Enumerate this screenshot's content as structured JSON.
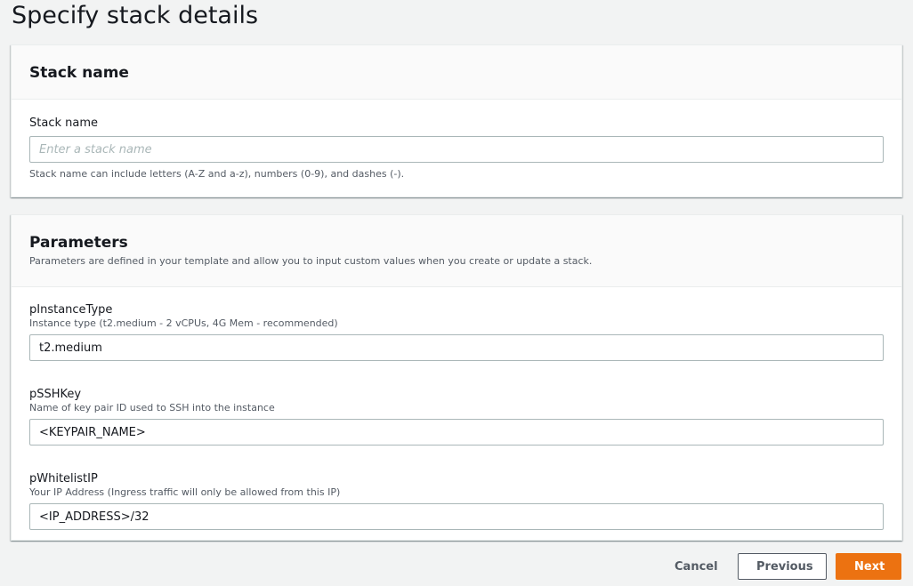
{
  "page": {
    "title": "Specify stack details"
  },
  "stack_name_panel": {
    "heading": "Stack name",
    "field_label": "Stack name",
    "placeholder": "Enter a stack name",
    "value": "",
    "hint": "Stack name can include letters (A-Z and a-z), numbers (0-9), and dashes (-)."
  },
  "parameters_panel": {
    "heading": "Parameters",
    "description": "Parameters are defined in your template and allow you to input custom values when you create or update a stack.",
    "params": [
      {
        "label": "pInstanceType",
        "description": "Instance type (t2.medium - 2 vCPUs, 4G Mem - recommended)",
        "value": "t2.medium"
      },
      {
        "label": "pSSHKey",
        "description": "Name of key pair ID used to SSH into the instance",
        "value": "<KEYPAIR_NAME>"
      },
      {
        "label": "pWhitelistIP",
        "description": "Your IP Address (Ingress traffic will only be allowed from this IP)",
        "value": "<IP_ADDRESS>/32"
      }
    ]
  },
  "footer": {
    "cancel_label": "Cancel",
    "previous_label": "Previous",
    "next_label": "Next"
  },
  "colors": {
    "primary": "#ec7211",
    "background": "#f2f3f3",
    "border": "#aab7b8",
    "secondary_text": "#545b64"
  }
}
